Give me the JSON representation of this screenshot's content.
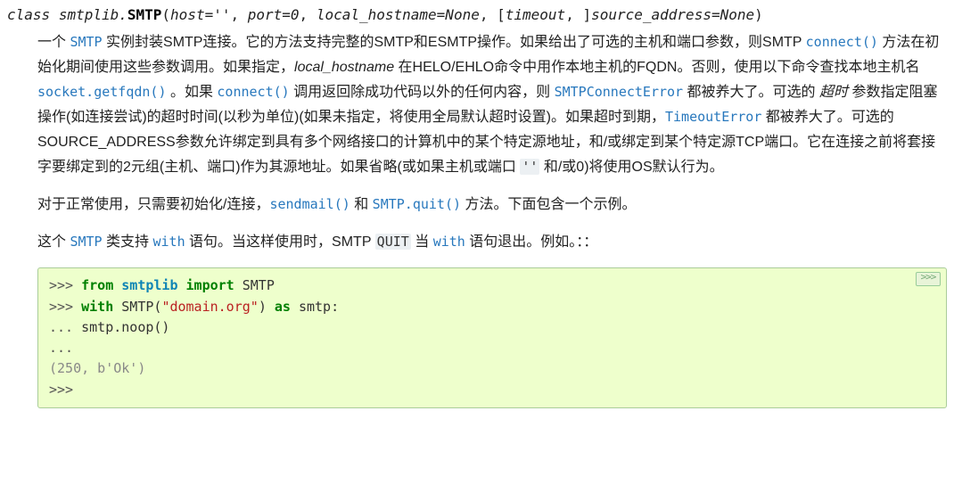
{
  "signature": {
    "class_kw": "class",
    "module": "smtplib.",
    "classname": "SMTP",
    "open": "(",
    "p1": "host=''",
    "c1": ", ",
    "p2": "port=0",
    "c2": ", ",
    "p3": "local_hostname=None",
    "c3": ", ",
    "lb": "[",
    "p4": "timeout",
    "c4": ", ",
    "rb": "]",
    "p5": "source_address=None",
    "close": ")"
  },
  "para1": {
    "t1": "一个 ",
    "smtp": "SMTP",
    "t2": " 实例封装SMTP连接。它的方法支持完整的SMTP和ESMTP操作。如果给出了可选的主机和端口参数，则SMTP ",
    "connect1": "connect()",
    "t3": " 方法在初始化期间使用这些参数调用。如果指定，",
    "lh": "local_hostname",
    "t4": " 在HELO/EHLO命令中用作本地主机的FQDN。否则，使用以下命令查找本地主机名 ",
    "getfqdn": "socket.getfqdn()",
    "t5": " 。如果 ",
    "connect2": "connect()",
    "t6": " 调用返回除成功代码以外的任何内容，则 ",
    "smtperr": "SMTPConnectError",
    "t7": " 都被养大了。可选的 ",
    "timeout_it": "超时",
    "t8": " 参数指定阻塞操作(如连接尝试)的超时时间(以秒为单位)(如果未指定，将使用全局默认超时设置)。如果超时到期，",
    "terr": "TimeoutError",
    "t9": " 都被养大了。可选的SOURCE_ADDRESS参数允许绑定到具有多个网络接口的计算机中的某个特定源地址，和/或绑定到某个特定源TCP端口。它在连接之前将套接字要绑定到的2元组(主机、端口)作为其源地址。如果省略(或如果主机或端口 ",
    "emptylit": "''",
    "t10": " 和/或0)将使用OS默认行为。"
  },
  "para2": {
    "t1": "对于正常使用，只需要初始化/连接，",
    "sendmail": "sendmail()",
    "t2": " 和 ",
    "quit": "SMTP.quit()",
    "t3": " 方法。下面包含一个示例。"
  },
  "para3": {
    "t1": "这个 ",
    "smtp": "SMTP",
    "t2": " 类支持 ",
    "with1": "with",
    "t3": " 语句。当这样使用时，SMTP ",
    "quitlit": "QUIT",
    "t4": " 当 ",
    "with2": "with",
    "t5": " 语句退出。例如。：："
  },
  "code": {
    "copylabel": ">>>",
    "l1_prompt": ">>> ",
    "l1_from": "from",
    "l1_mod": " smtplib ",
    "l1_import": "import",
    "l1_name": " SMTP",
    "l2_prompt": ">>> ",
    "l2_with": "with",
    "l2_a": " SMTP(",
    "l2_str": "\"domain.org\"",
    "l2_b": ") ",
    "l2_as": "as",
    "l2_c": " smtp:",
    "l3_prompt": "... ",
    "l3_body": "    smtp.noop()",
    "l4_prompt": "...",
    "l5_out": "(250, b'Ok')",
    "l6_prompt": ">>>"
  }
}
